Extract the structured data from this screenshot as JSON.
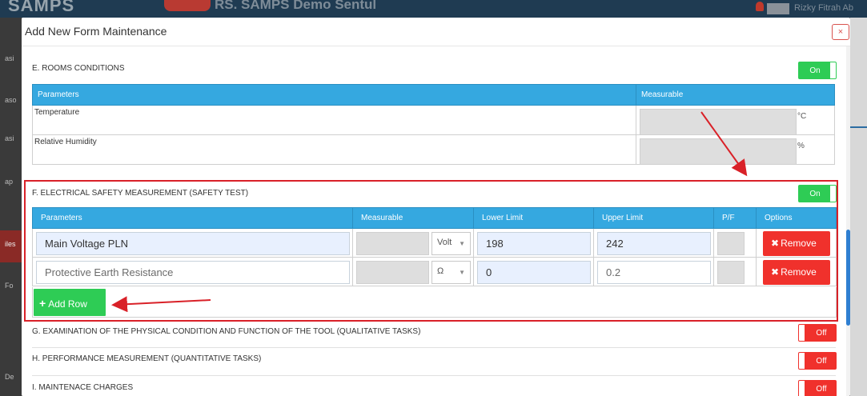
{
  "background": {
    "logo": "SAMPS",
    "hospital": "RS. SAMPS Demo Sentul",
    "user": "Rizky Fitrah Ab",
    "sidebar_items": [
      "asi",
      "aso",
      "asi",
      "ap",
      "iles",
      "Fo",
      "",
      "",
      "De"
    ]
  },
  "modal": {
    "title": "Add New Form Maintenance",
    "close_icon": "×"
  },
  "rooms": {
    "title": "E. ROOMS CONDITIONS",
    "toggle": "On",
    "headers": [
      "Parameters",
      "Measurable"
    ],
    "rows": [
      {
        "param": "Temperature",
        "unit": "°C"
      },
      {
        "param": "Relative Humidity",
        "unit": "%"
      }
    ]
  },
  "electrical": {
    "title": "F. ELECTRICAL SAFETY MEASUREMENT (SAFETY TEST)",
    "toggle": "On",
    "headers": [
      "Parameters",
      "Measurable",
      "Lower Limit",
      "Upper Limit",
      "P/F",
      "Options"
    ],
    "rows": [
      {
        "param": "Main Voltage PLN",
        "unit": "Volt",
        "lower": "198",
        "upper": "242",
        "remove": "Remove"
      },
      {
        "param": "Protective Earth Resistance",
        "unit": "Ω",
        "lower": "0",
        "upper": "0.2",
        "remove": "Remove"
      }
    ],
    "add_row": "Add Row",
    "caret": "▼",
    "remove_icon": "✖",
    "add_icon": "+"
  },
  "sections": [
    {
      "title": "G. EXAMINATION OF THE PHYSICAL CONDITION AND FUNCTION OF THE TOOL (QUALITATIVE TASKS)",
      "toggle": "Off"
    },
    {
      "title": "H. PERFORMANCE MEASUREMENT (QUANTITATIVE TASKS)",
      "toggle": "Off"
    },
    {
      "title": "I. MAINTENACE CHARGES",
      "toggle": "Off"
    }
  ],
  "colors": {
    "header_blue": "#35a8e0",
    "on_green": "#2ecc55",
    "off_red": "#f0312c",
    "annotation_red": "#d92128"
  }
}
